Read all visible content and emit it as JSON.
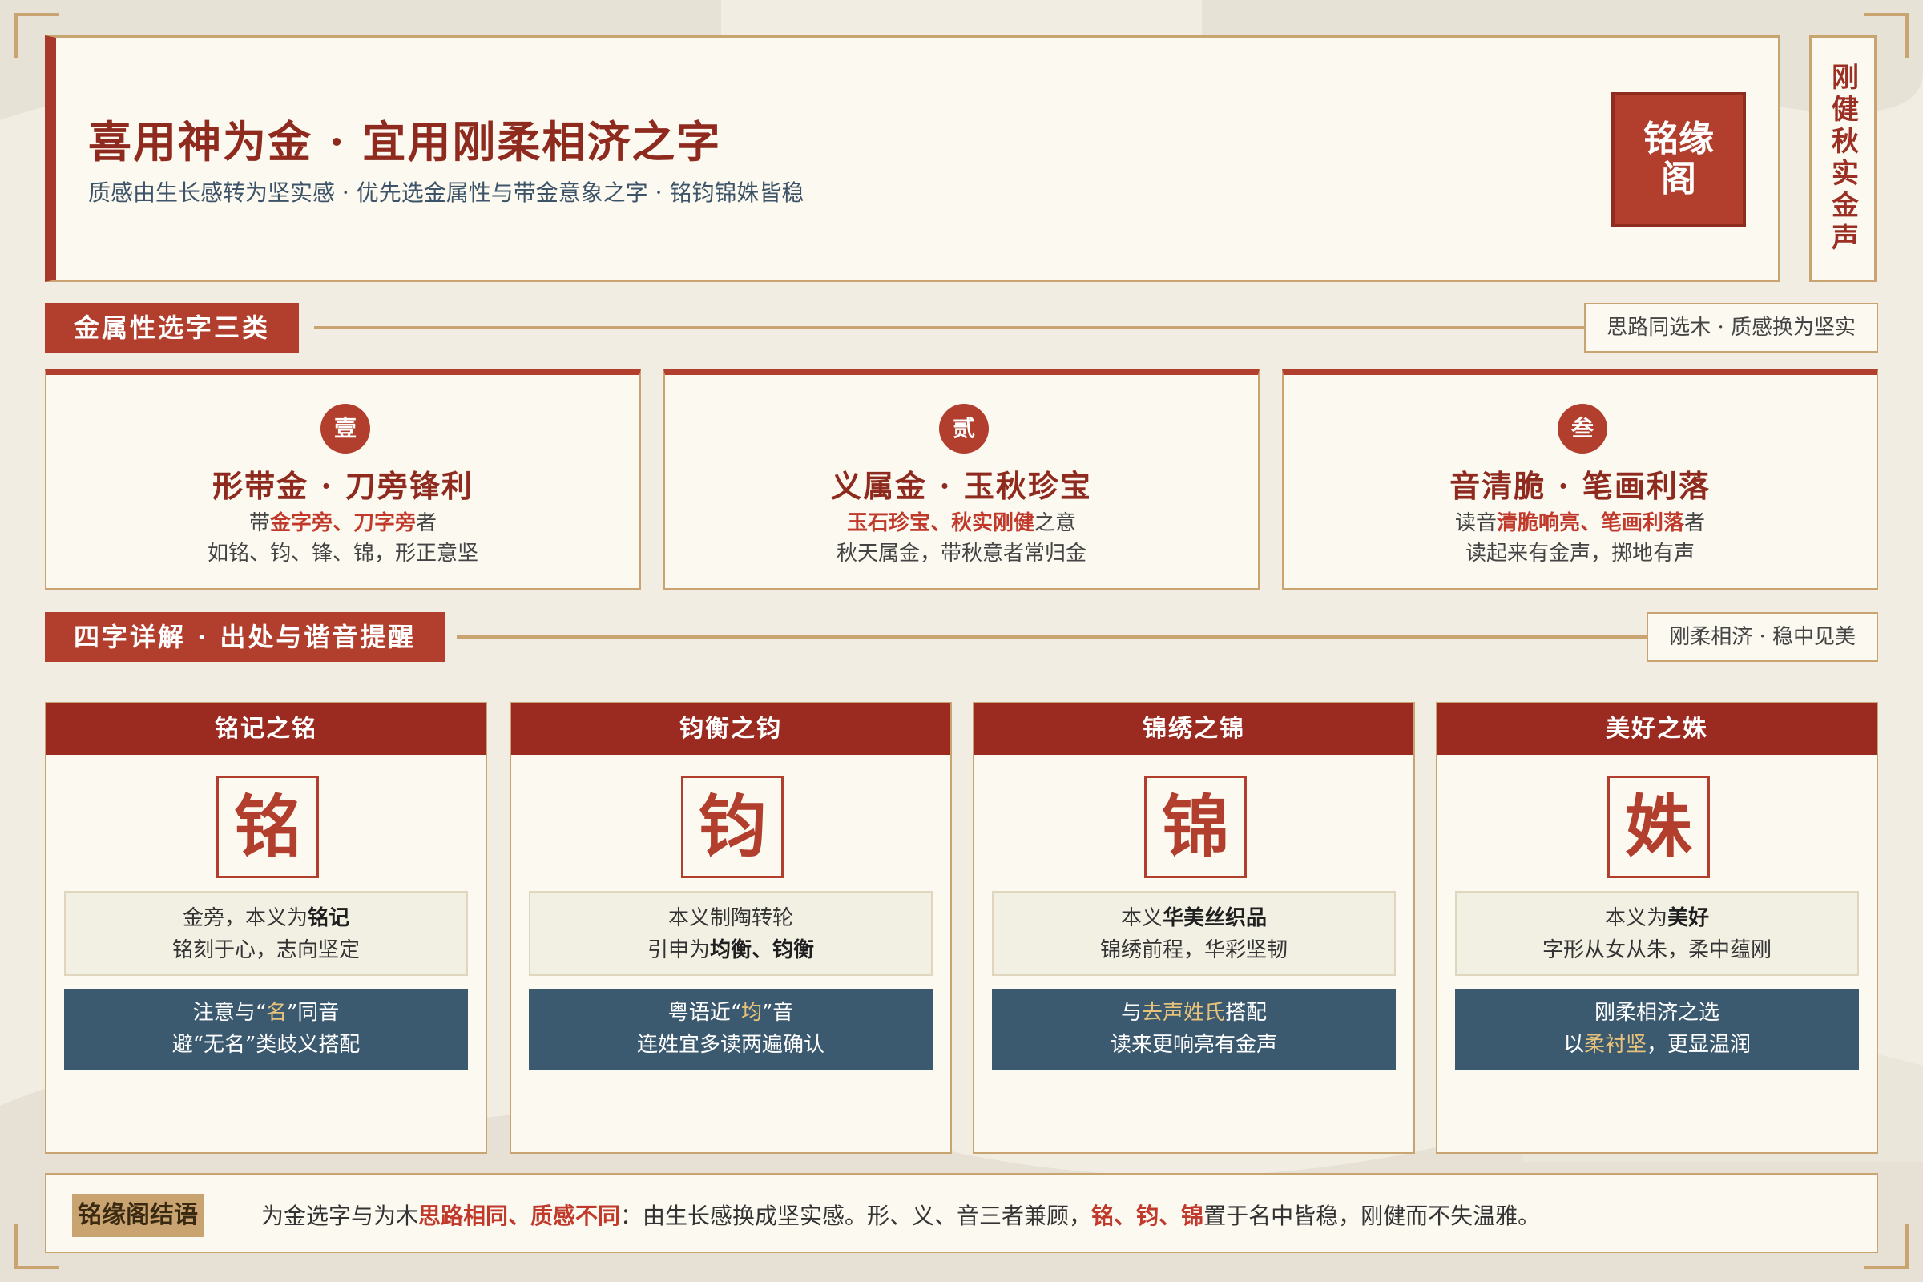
{
  "colors": {
    "accent_red": "#b23e2d",
    "deep_red": "#8f2a1f",
    "gold": "#c9a470",
    "slate_blue": "#3b5a70",
    "paper": "#fcf9f0",
    "background": "#f1ede3"
  },
  "header": {
    "title": "喜用神为金 · 宜用刚柔相济之字",
    "subtitle": "质感由生长感转为坚实感 · 优先选金属性与带金意象之字 · 铭钧锦姝皆稳",
    "seal_line1": "铭缘",
    "seal_line2": "阁"
  },
  "side_vertical": "刚健秋实金声",
  "section1": {
    "tag": "金属性选字三类",
    "note": "思路同选木 · 质感换为坚实"
  },
  "categories": [
    {
      "num": "壹",
      "title": "形带金 · 刀旁锋利",
      "l1_pre": "带",
      "l1_hl": "金字旁、刀字旁",
      "l1_post": "者",
      "l2": "如铭、钧、锋、锦，形正意坚"
    },
    {
      "num": "贰",
      "title": "义属金 · 玉秋珍宝",
      "l1_pre": "",
      "l1_hl": "玉石珍宝、秋实刚健",
      "l1_post": "之意",
      "l2": "秋天属金，带秋意者常归金"
    },
    {
      "num": "叁",
      "title": "音清脆 · 笔画利落",
      "l1_pre": "读音",
      "l1_hl": "清脆响亮、笔画利落",
      "l1_post": "者",
      "l2": "读起来有金声，掷地有声"
    }
  ],
  "section2": {
    "tag": "四字详解 · 出处与谐音提醒",
    "note": "刚柔相济 · 稳中见美"
  },
  "characters": [
    {
      "head": "铭记之铭",
      "char": "铭",
      "m1_pre": "金旁，本义为",
      "m1_b": "铭记",
      "m1_post": "",
      "m2_pre": "铭刻于心，志向坚定",
      "m2_b": "",
      "m2_post": "",
      "n1_pre": "注意与“",
      "n1_g": "名",
      "n1_post": "”同音",
      "n2_pre": "避“无名”类歧义搭配",
      "n2_g": "",
      "n2_post": ""
    },
    {
      "head": "钧衡之钧",
      "char": "钧",
      "m1_pre": "本义制陶转轮",
      "m1_b": "",
      "m1_post": "",
      "m2_pre": "引申为",
      "m2_b": "均衡、钧衡",
      "m2_post": "",
      "n1_pre": "粤语近“",
      "n1_g": "均",
      "n1_post": "”音",
      "n2_pre": "连姓宜多读两遍确认",
      "n2_g": "",
      "n2_post": ""
    },
    {
      "head": "锦绣之锦",
      "char": "锦",
      "m1_pre": "本义",
      "m1_b": "华美丝织品",
      "m1_post": "",
      "m2_pre": "锦绣前程，华彩坚韧",
      "m2_b": "",
      "m2_post": "",
      "n1_pre": "与",
      "n1_g": "去声姓氏",
      "n1_post": "搭配",
      "n2_pre": "读来更响亮有金声",
      "n2_g": "",
      "n2_post": ""
    },
    {
      "head": "美好之姝",
      "char": "姝",
      "m1_pre": "本义为",
      "m1_b": "美好",
      "m1_post": "",
      "m2_pre": "字形从女从朱，柔中蕴刚",
      "m2_b": "",
      "m2_post": "",
      "n1_pre": "刚柔相济之选",
      "n1_g": "",
      "n1_post": "",
      "n2_pre": "以",
      "n2_g": "柔衬坚",
      "n2_post": "，更显温润"
    }
  ],
  "footer": {
    "tag": "铭缘阁结语",
    "t1": "为金选字与为木",
    "t1_hl": "思路相同、质感不同",
    "t2": "：由生长感换成坚实感。形、义、音三者兼顾，",
    "t2_hl": "铭、钧、锦",
    "t3": "置于名中皆稳，刚健而不失温雅。"
  }
}
